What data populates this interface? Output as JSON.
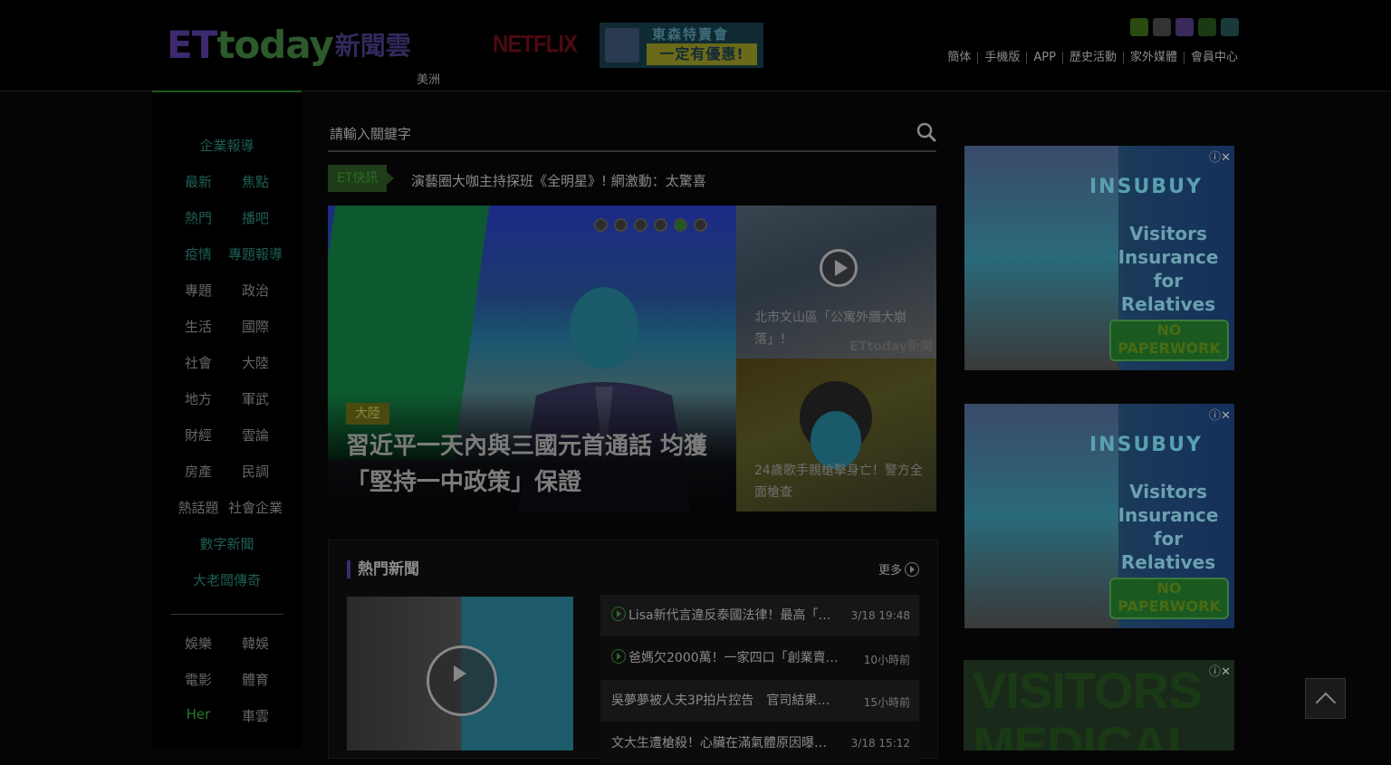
{
  "header": {
    "logo_et": "ET",
    "logo_today": "today",
    "logo_cloud": "新聞雲",
    "edition": "美洲",
    "netflix": "NETFLIX",
    "promo_line1": "東森特賣會",
    "promo_line2": "一定有優惠!",
    "social_icons": [
      "facebook-icon",
      "youtube-icon",
      "instagram-icon",
      "rss-icon",
      "line-icon"
    ],
    "nav": [
      "簡体",
      "手機版",
      "APP",
      "歷史活動",
      "家外媒體",
      "會員中心"
    ]
  },
  "leftnav": {
    "enterprise": "企業報導",
    "pairs": [
      [
        "最新",
        "焦點"
      ],
      [
        "熱門",
        "播吧"
      ],
      [
        "疫情",
        "專題報導"
      ],
      [
        "專題",
        "政治"
      ],
      [
        "生活",
        "國際"
      ],
      [
        "社會",
        "大陸"
      ],
      [
        "地方",
        "軍武"
      ],
      [
        "財經",
        "雲論"
      ],
      [
        "房產",
        "民調"
      ],
      [
        "熱話題",
        "社會企業"
      ]
    ],
    "numeric_news": "數字新聞",
    "boss_legend": "大老闆傳奇",
    "pairs2": [
      [
        "娛樂",
        "韓娛"
      ],
      [
        "電影",
        "體育"
      ],
      [
        "Her",
        "車雲"
      ]
    ]
  },
  "search": {
    "placeholder": "請輸入關鍵字"
  },
  "flash": {
    "tag": "ET快訊",
    "text": "演藝圈大咖主持探班《全明星》! 網激動：太驚喜"
  },
  "hero": {
    "tag": "大陸",
    "title": "習近平一天內與三國元首通話 均獲「堅持一中政策」保證",
    "dots": 6,
    "active_dot": 5
  },
  "side": [
    {
      "caption": "北市文山區「公寓外牆大崩落」！",
      "watermark": "ETtoday新聞"
    },
    {
      "caption": "24歲歌手親槍擊身亡！警方全面槍查"
    }
  ],
  "hot": {
    "title": "熱門新聞",
    "more": "更多",
    "rows": [
      {
        "title": "Lisa新代言違反泰國法律！最高「…",
        "date": "3/18 19:48",
        "video": true
      },
      {
        "title": "爸媽欠2000萬！一家四口「創業賣…",
        "date": "10小時前",
        "video": true
      },
      {
        "title": "吳夢夢被人夫3P拍片控告　官司結果…",
        "date": "15小時前",
        "video": false
      },
      {
        "title": "文大生遭槍殺！心臟在滿氣體原因曝…",
        "date": "3/18 15:12",
        "video": false
      }
    ]
  },
  "ads": [
    {
      "logo": "INSUBUY",
      "copy": "Visitors Insurance for Relatives Visiting USA",
      "button": "NO PAPERWORK"
    },
    {
      "logo": "INSUBUY",
      "copy": "Visitors Insurance for Relatives Visiting USA",
      "button": "NO PAPERWORK"
    }
  ],
  "ad3": {
    "text": "VISITORS MEDICAL"
  },
  "ad_close": "ⓘ✕"
}
